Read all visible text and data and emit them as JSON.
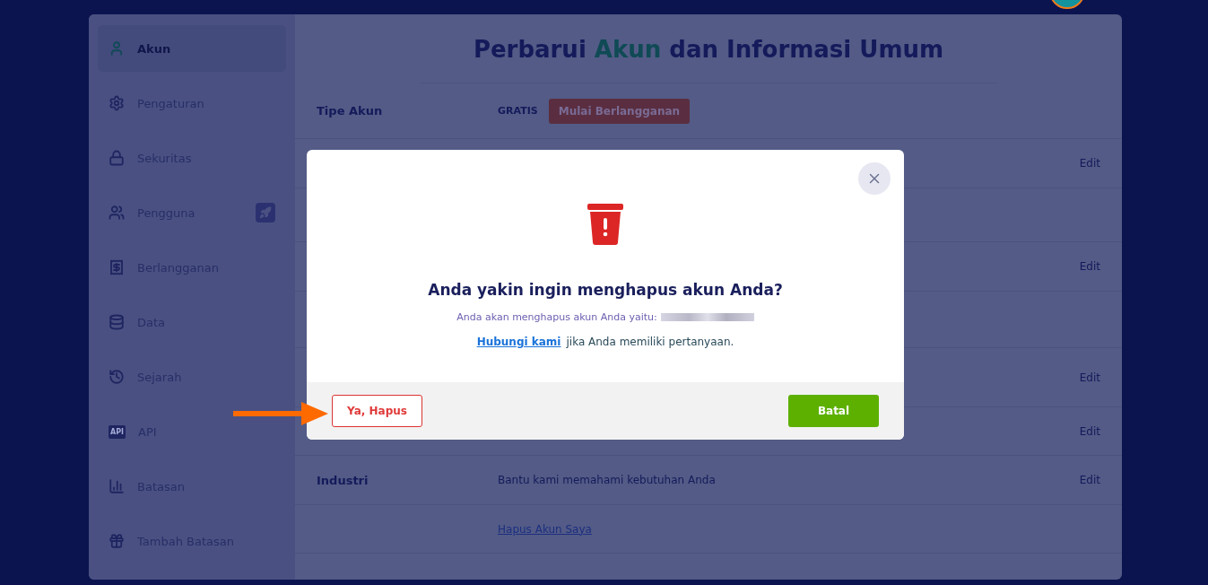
{
  "sidebar": {
    "items": [
      {
        "label": "Akun",
        "selected": true,
        "rocket": false
      },
      {
        "label": "Pengaturan",
        "selected": false,
        "rocket": false
      },
      {
        "label": "Sekuritas",
        "selected": false,
        "rocket": false
      },
      {
        "label": "Pengguna",
        "selected": false,
        "rocket": true
      },
      {
        "label": "Berlangganan",
        "selected": false,
        "rocket": false
      },
      {
        "label": "Data",
        "selected": false,
        "rocket": false
      },
      {
        "label": "Sejarah",
        "selected": false,
        "rocket": false
      },
      {
        "label": "API",
        "selected": false,
        "rocket": false,
        "icon_text": "API"
      },
      {
        "label": "Batasan",
        "selected": false,
        "rocket": false
      },
      {
        "label": "Tambah Batasan",
        "selected": false,
        "rocket": false
      }
    ]
  },
  "page": {
    "title_before": "Perbarui ",
    "title_accent": "Akun",
    "title_after": " dan Informasi Umum"
  },
  "rows": [
    {
      "label": "Tipe Akun",
      "value": "GRATIS",
      "button": "Mulai Berlangganan"
    },
    {
      "action": "Edit"
    },
    {},
    {
      "action": "Edit"
    },
    {},
    {
      "action": "Edit"
    },
    {
      "action": "Edit"
    },
    {
      "label": "Industri",
      "value": "Bantu kami memahami kebutuhan Anda",
      "action": "Edit"
    },
    {
      "link": "Hapus Akun Saya"
    }
  ],
  "dialog": {
    "heading": "Anda yakin ingin menghapus akun Anda?",
    "message": "Anda akan menghapus akun Anda yaitu:",
    "contact_link": "Hubungi kami",
    "contact_text": "jika Anda memiliki pertanyaan.",
    "confirm": "Ya, Hapus",
    "cancel": "Batal"
  }
}
